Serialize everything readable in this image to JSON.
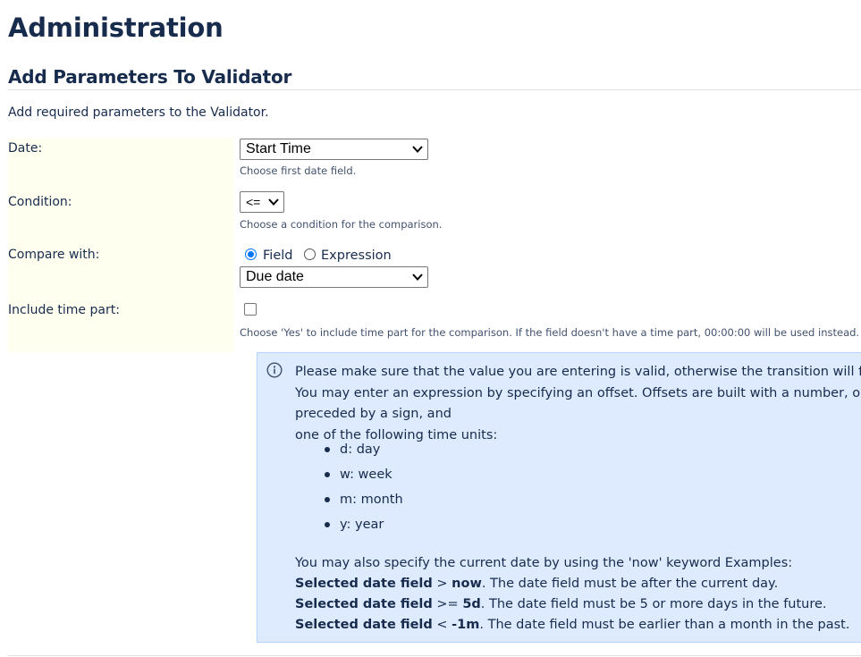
{
  "page": {
    "title": "Administration",
    "section_title": "Add Parameters To Validator",
    "intro": "Add required parameters to the Validator."
  },
  "form": {
    "date": {
      "label": "Date:",
      "value": "Start Time",
      "description": "Choose first date field."
    },
    "condition": {
      "label": "Condition:",
      "value": "<=",
      "description": "Choose a condition for the comparison."
    },
    "compare_with": {
      "label": "Compare with:",
      "options": [
        {
          "label": "Field",
          "checked": true
        },
        {
          "label": "Expression",
          "checked": false
        }
      ],
      "value": "Due date"
    },
    "include_time": {
      "label": "Include time part:",
      "checked": false,
      "description": "Choose 'Yes' to include time part for the comparison. If the field doesn't have a time part, 00:00:00 will be used instead."
    }
  },
  "info": {
    "line1": "Please make sure that the value you are entering is valid, otherwise the transition will fail.",
    "line2": "You may enter an expression by specifying an offset. Offsets are built with a number, optionally preceded by a sign, and",
    "line3": "one of the following time units:",
    "units": [
      "d: day",
      "w: week",
      "m: month",
      "y: year"
    ],
    "now_intro": "You may also specify the current date by using the 'now' keyword Examples:",
    "examples": [
      {
        "field": "Selected date field",
        "op": ">",
        "value": "now",
        "text": ". The date field must be after the current day."
      },
      {
        "field": "Selected date field",
        "op": ">=",
        "value": "5d",
        "text": ". The date field must be 5 or more days in the future."
      },
      {
        "field": "Selected date field",
        "op": "<",
        "value": "-1m",
        "text": ". The date field must be earlier than a month in the past."
      }
    ]
  },
  "colors": {
    "label_bg": "#fffff0",
    "info_bg": "#deebff",
    "info_border": "#b3d4ff",
    "radio_accent": "#0075ff"
  },
  "icons": {
    "select_arrow": "chevron-down-icon",
    "info": "info-icon"
  }
}
